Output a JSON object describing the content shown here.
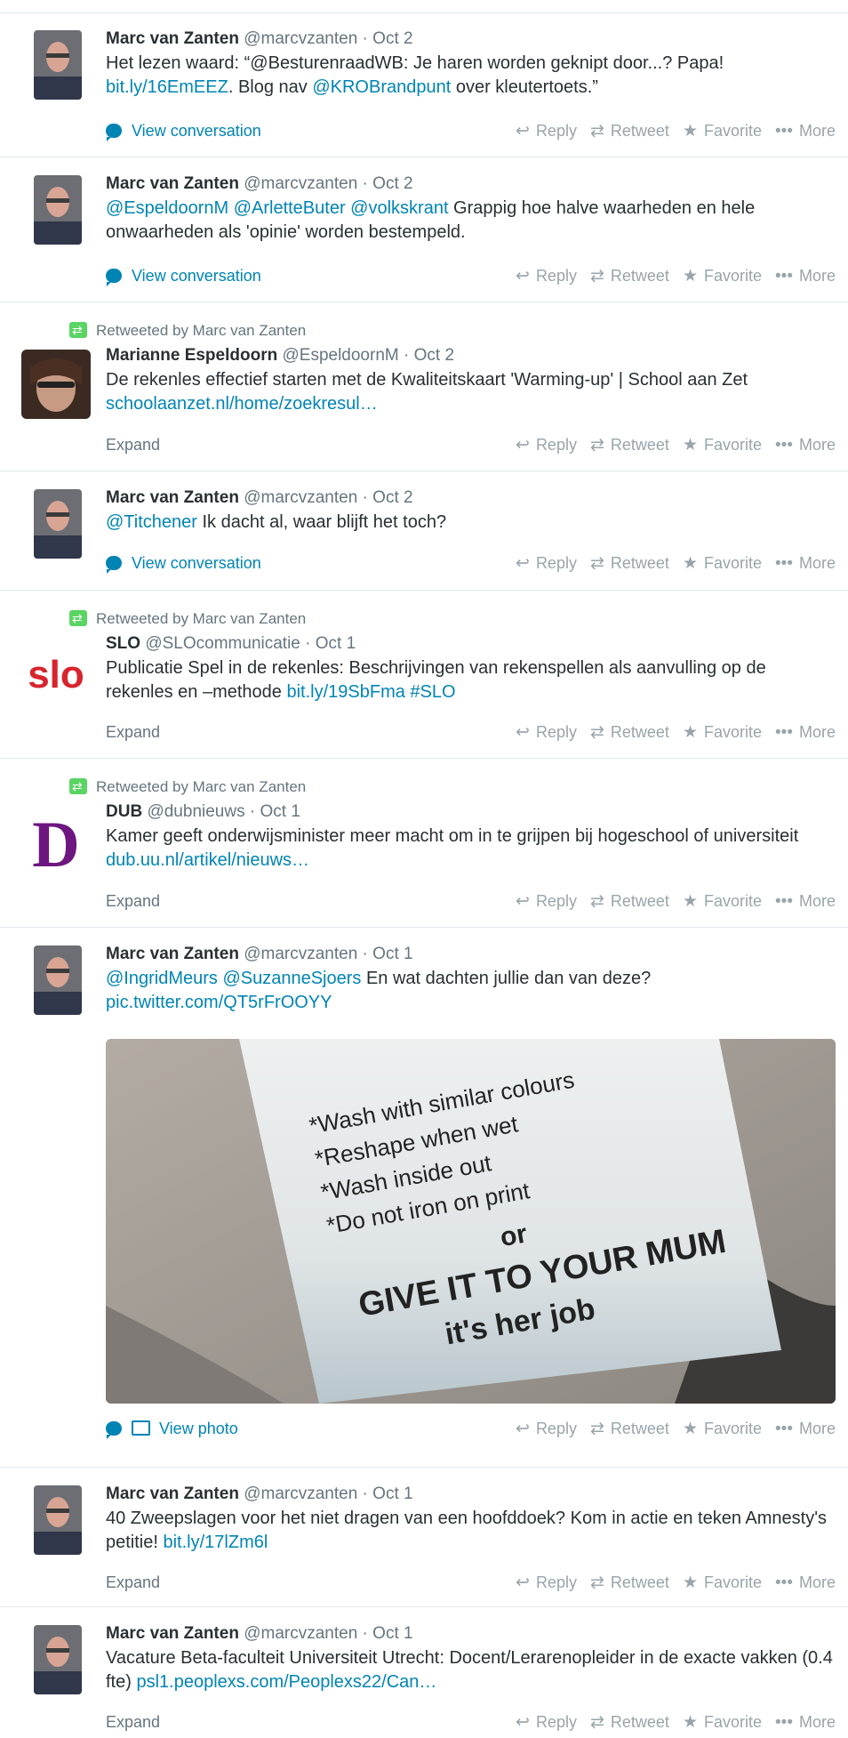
{
  "actions": {
    "reply": "Reply",
    "retweet": "Retweet",
    "favorite": "Favorite",
    "more": "More"
  },
  "tweets": [
    {
      "name": "Marc van Zanten",
      "handle": "@marcvzanten",
      "time": "Oct 2",
      "t1": "Het lezen waard: “@BesturenraadWB: Je haren worden geknipt door...? Papa! ",
      "l1": "bit.ly/16EmEEZ",
      "t2": ". Blog nav ",
      "l2": "@KROBrandpunt",
      "t3": " over kleutertoets.”",
      "footer": "View conversation"
    },
    {
      "name": "Marc van Zanten",
      "handle": "@marcvzanten",
      "time": "Oct 2",
      "l1": "@EspeldoornM @ArletteButer @volkskrant",
      "t1": " Grappig hoe halve waarheden en hele onwaarheden als 'opinie' worden bestempeld.",
      "footer": "View conversation"
    },
    {
      "context": "Retweeted by Marc van Zanten",
      "name": "Marianne Espeldoorn",
      "handle": "@EspeldoornM",
      "time": "Oct 2",
      "t1": "De rekenles effectief starten met de Kwaliteitskaart 'Warming-up' | School aan Zet ",
      "l1": "schoolaanzet.nl/home/zoekresul…",
      "footer": "Expand"
    },
    {
      "name": "Marc van Zanten",
      "handle": "@marcvzanten",
      "time": "Oct 2",
      "l1": "@Titchener",
      "t1": " Ik dacht al, waar blijft het toch?",
      "footer": "View conversation"
    },
    {
      "context": "Retweeted by Marc van Zanten",
      "name": "SLO",
      "handle": "@SLOcommunicatie",
      "time": "Oct 1",
      "t1": "Publicatie Spel in de rekenles: Beschrijvingen van rekenspellen als aanvulling op de rekenles en –methode ",
      "l1": "bit.ly/19SbFma #SLO",
      "footer": "Expand",
      "logo": "slo"
    },
    {
      "context": "Retweeted by Marc van Zanten",
      "name": "DUB",
      "handle": "@dubnieuws",
      "time": "Oct 1",
      "t1": "Kamer geeft onderwijsminister meer macht om in te grijpen bij hogeschool of universiteit ",
      "l1": "dub.uu.nl/artikel/nieuws…",
      "footer": "Expand",
      "logo": "D"
    },
    {
      "name": "Marc van Zanten",
      "handle": "@marcvzanten",
      "time": "Oct 1",
      "l1": "@IngridMeurs @SuzanneSjoers",
      "t1": " En wat dachten jullie dan van deze?",
      "l2": "pic.twitter.com/QT5rFrOOYY",
      "footer": "View photo",
      "label": [
        "*Wash with similar colours",
        "*Reshape when wet",
        "*Wash inside out",
        "*Do not iron on print",
        "or",
        "GIVE IT TO YOUR MUM",
        "it's her job"
      ]
    },
    {
      "name": "Marc van Zanten",
      "handle": "@marcvzanten",
      "time": "Oct 1",
      "t1": "40 Zweepslagen voor het niet dragen van een hoofddoek? Kom in actie en teken Amnesty's petitie! ",
      "l1": "bit.ly/17lZm6l",
      "footer": "Expand"
    },
    {
      "name": "Marc van Zanten",
      "handle": "@marcvzanten",
      "time": "Oct 1",
      "t1": "Vacature Beta-faculteit Universiteit Utrecht: Docent/Lerarenopleider in de exacte vakken (0.4 fte) ",
      "l1": "psl1.peoplexs.com/Peoplexs22/Can…",
      "footer": "Expand"
    }
  ]
}
